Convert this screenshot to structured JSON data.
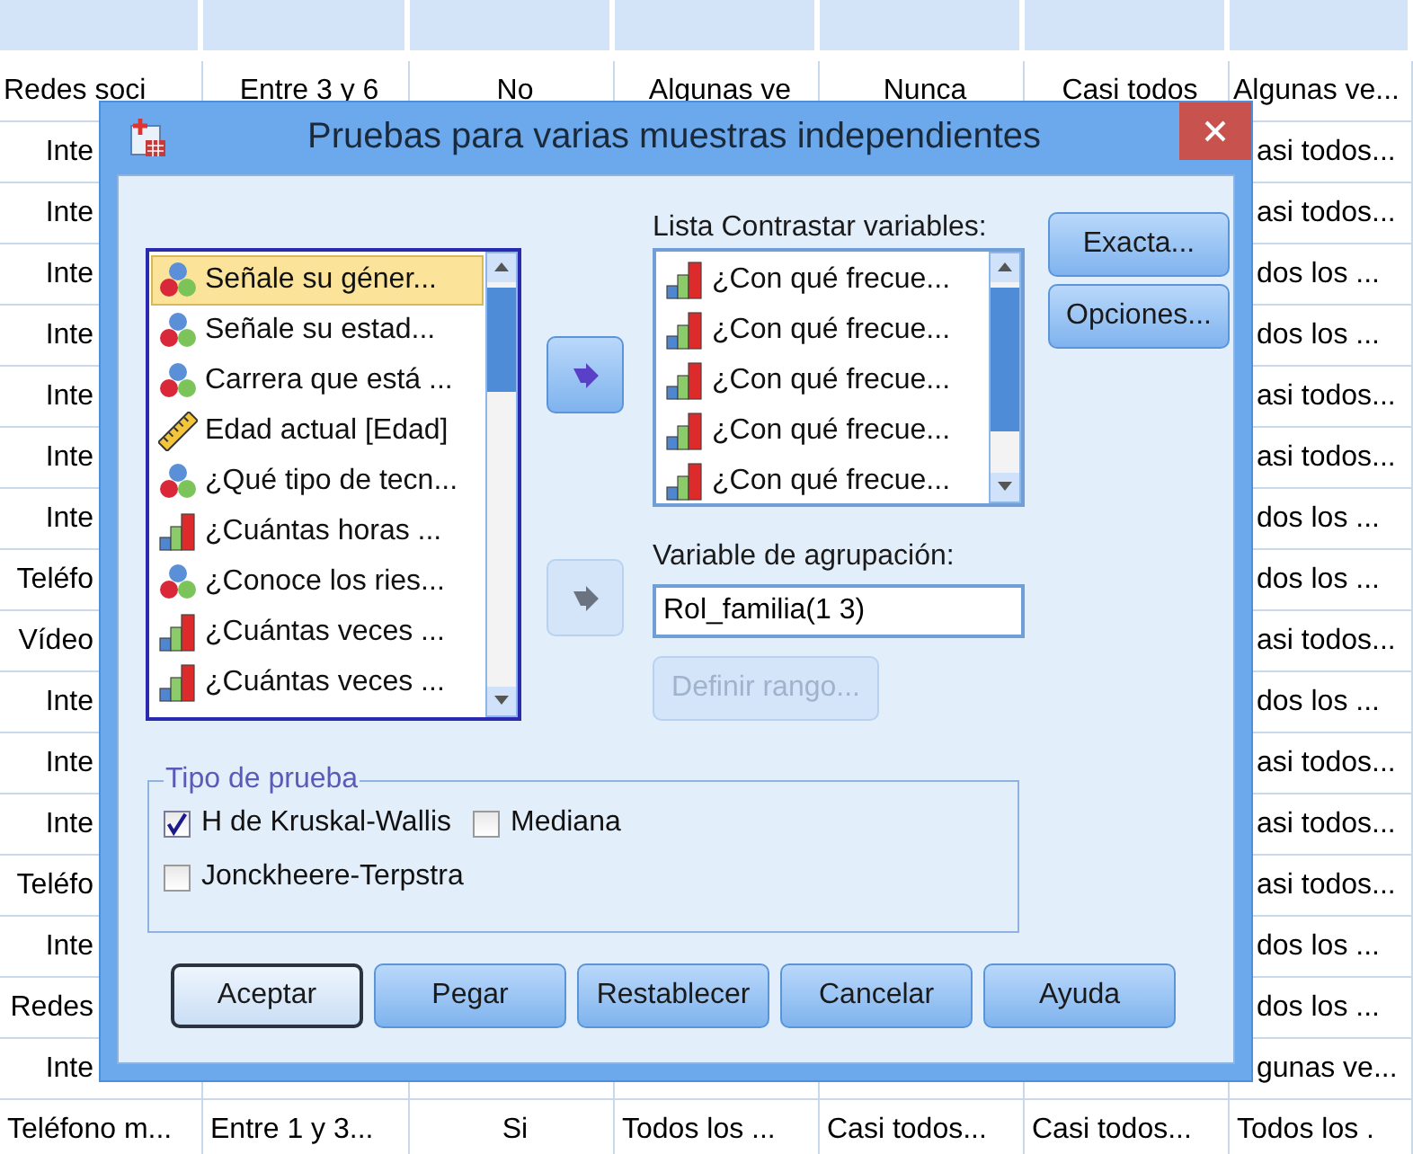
{
  "grid": {
    "top_row": [
      "Redes soci",
      "Entre 3 y 6",
      "No",
      "Algunas ve",
      "Nunca",
      "Casi todos",
      "Algunas ve..."
    ],
    "rows": [
      {
        "left": "Inte",
        "right": "asi todos..."
      },
      {
        "left": "Inte",
        "right": "asi todos..."
      },
      {
        "left": "Inte",
        "right": "dos los ..."
      },
      {
        "left": "Inte",
        "right": "dos los ..."
      },
      {
        "left": "Inte",
        "right": "asi todos..."
      },
      {
        "left": "Inte",
        "right": "asi todos..."
      },
      {
        "left": "Inte",
        "right": "dos los ..."
      },
      {
        "left": "Teléfo",
        "right": "dos los ..."
      },
      {
        "left": "Vídeo",
        "right": "asi todos..."
      },
      {
        "left": "Inte",
        "right": "dos los ..."
      },
      {
        "left": "Inte",
        "right": "asi todos..."
      },
      {
        "left": "Inte",
        "right": "asi todos..."
      },
      {
        "left": "Teléfo",
        "right": "asi todos..."
      },
      {
        "left": "Inte",
        "right": "dos los ..."
      },
      {
        "left": "Redes",
        "right": "dos los ..."
      },
      {
        "left": "Inte",
        "right": "gunas ve..."
      }
    ],
    "bottom_row": [
      "Teléfono m...",
      "Entre 1 y 3...",
      "Si",
      "Todos los ...",
      "Casi todos...",
      "Casi todos...",
      "Todos los ."
    ]
  },
  "dialog": {
    "title": "Pruebas para varias muestras independientes",
    "source_list": [
      {
        "kind": "nominal",
        "label": "Señale su géner...",
        "selected": true
      },
      {
        "kind": "nominal",
        "label": "Señale su estad...",
        "selected": false
      },
      {
        "kind": "nominal",
        "label": "Carrera que está ...",
        "selected": false
      },
      {
        "kind": "scale",
        "label": "Edad actual [Edad]",
        "selected": false
      },
      {
        "kind": "nominal",
        "label": "¿Qué tipo de tecn...",
        "selected": false
      },
      {
        "kind": "ordinal",
        "label": "¿Cuántas horas ...",
        "selected": false
      },
      {
        "kind": "nominal",
        "label": "¿Conoce los ries...",
        "selected": false
      },
      {
        "kind": "ordinal",
        "label": "¿Cuántas veces ...",
        "selected": false
      },
      {
        "kind": "ordinal",
        "label": "¿Cuántas veces ...",
        "selected": false
      }
    ],
    "move_buttons": [
      {
        "disabled": false
      },
      {
        "disabled": true
      }
    ],
    "test_list": {
      "label": "Lista Contrastar variables:",
      "items": [
        {
          "kind": "ordinal",
          "label": "¿Con qué frecue..."
        },
        {
          "kind": "ordinal",
          "label": "¿Con qué frecue..."
        },
        {
          "kind": "ordinal",
          "label": "¿Con qué frecue..."
        },
        {
          "kind": "ordinal",
          "label": "¿Con qué frecue..."
        },
        {
          "kind": "ordinal",
          "label": "¿Con qué frecue..."
        }
      ]
    },
    "side_buttons": [
      "Exacta...",
      "Opciones..."
    ],
    "grouping": {
      "label": "Variable de agrupación:",
      "value": "Rol_familia(1 3)"
    },
    "define_range": {
      "label": "Definir rango...",
      "disabled": true
    },
    "test_type": {
      "title": "Tipo de prueba",
      "options": [
        {
          "label": "H de Kruskal-Wallis",
          "checked": true
        },
        {
          "label": "Mediana",
          "checked": false
        },
        {
          "label": "Jonckheere-Terpstra",
          "checked": false
        }
      ]
    },
    "buttons": [
      {
        "label": "Aceptar",
        "default": true
      },
      {
        "label": "Pegar",
        "default": false
      },
      {
        "label": "Restablecer",
        "default": false
      },
      {
        "label": "Cancelar",
        "default": false
      },
      {
        "label": "Ayuda",
        "default": false
      }
    ]
  }
}
